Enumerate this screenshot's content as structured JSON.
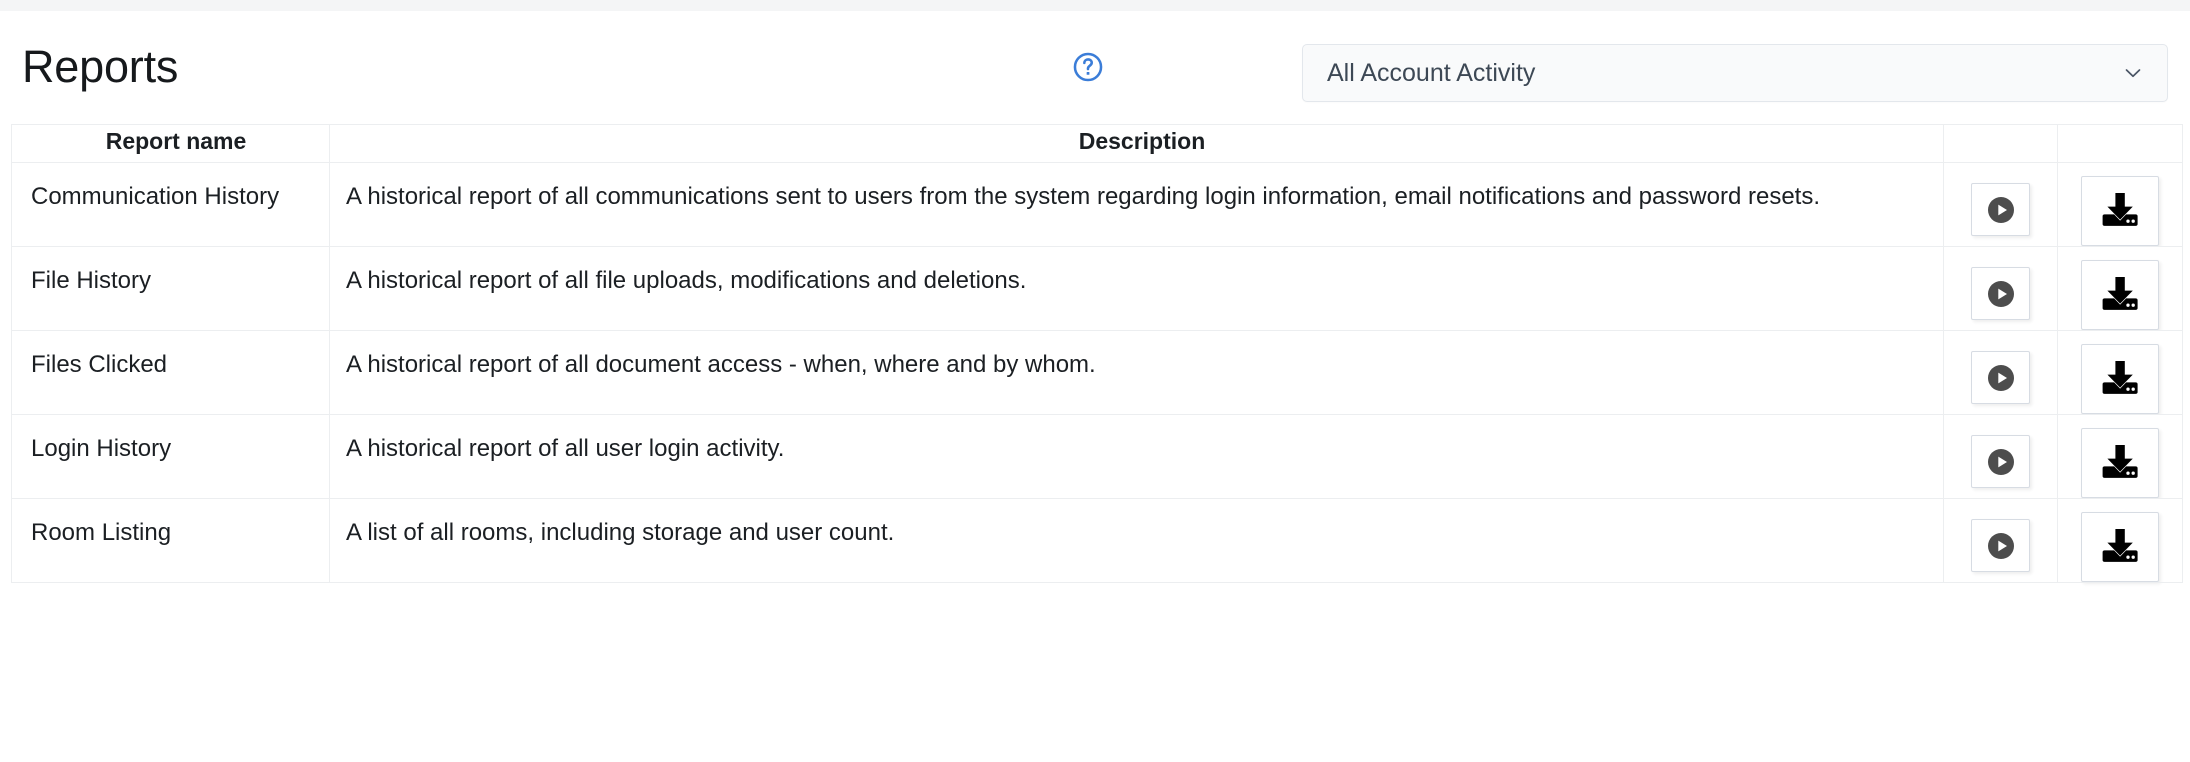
{
  "header": {
    "title": "Reports",
    "help_icon": "help-circle-icon",
    "account_filter": {
      "selected": "All Account Activity",
      "chevron_icon": "chevron-down-icon"
    }
  },
  "table": {
    "columns": [
      "Report name",
      "Description",
      "",
      ""
    ],
    "rows": [
      {
        "name": "Communication History",
        "description": "A historical report of all communications sent to users from the system regarding login information, email notifications and password resets.",
        "run_icon": "play-circle-icon",
        "download_icon": "download-tray-icon"
      },
      {
        "name": "File History",
        "description": "A historical report of all file uploads, modifications and deletions.",
        "run_icon": "play-circle-icon",
        "download_icon": "download-tray-icon"
      },
      {
        "name": "Files Clicked",
        "description": "A historical report of all document access - when, where and by whom.",
        "run_icon": "play-circle-icon",
        "download_icon": "download-tray-icon"
      },
      {
        "name": "Login History",
        "description": "A historical report of all user login activity.",
        "run_icon": "play-circle-icon",
        "download_icon": "download-tray-icon"
      },
      {
        "name": "Room Listing",
        "description": "A list of all rooms, including storage and user count.",
        "run_icon": "play-circle-icon",
        "download_icon": "download-tray-icon"
      }
    ]
  },
  "colors": {
    "help_blue": "#3b7dd8",
    "play_circle": "#4d4d4d",
    "text": "#1b1f23",
    "select_text": "#3d4855",
    "border": "#eceef0"
  }
}
